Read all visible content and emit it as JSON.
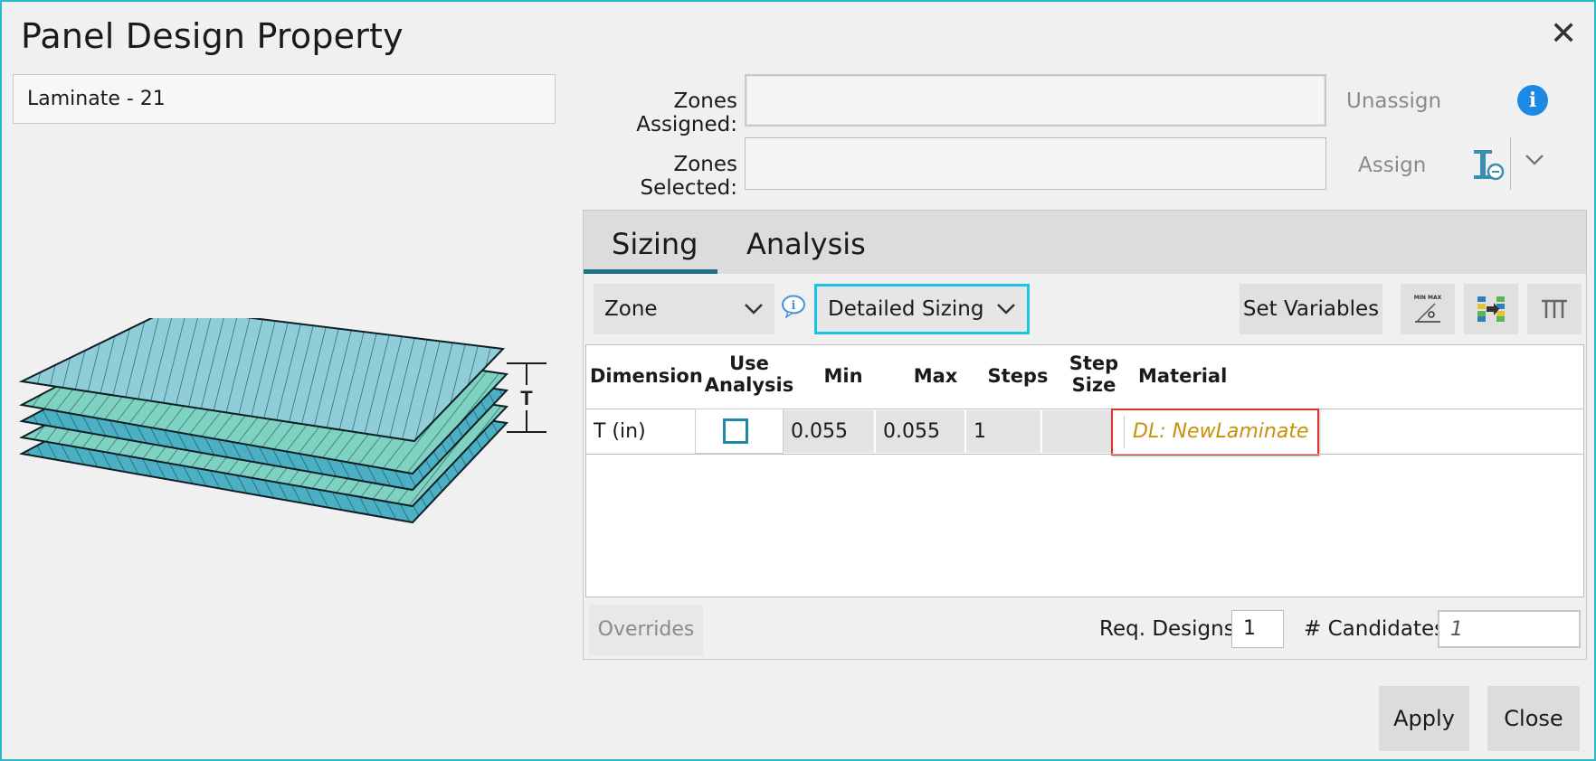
{
  "dialog": {
    "title": "Panel Design Property",
    "close_glyph": "✕"
  },
  "left": {
    "name_value": "Laminate - 21",
    "thickness_label": "T"
  },
  "zones": {
    "assigned_label": "Zones Assigned:",
    "selected_label": "Zones Selected:",
    "assigned_value": "",
    "selected_value": "",
    "unassign_label": "Unassign",
    "assign_label": "Assign",
    "info_glyph": "i"
  },
  "tabs": [
    {
      "label": "Sizing",
      "active": true
    },
    {
      "label": "Analysis",
      "active": false
    }
  ],
  "sizing": {
    "zone_dropdown": "Zone",
    "mode_dropdown": "Detailed Sizing",
    "set_variables_label": "Set Variables",
    "toolbar_icons": [
      "min-max-icon",
      "matrix-transfer-icon",
      "columns-icon"
    ],
    "min_max_icon_text": "MIN MAX",
    "columns": {
      "dimension": "Dimension",
      "use_analysis": [
        "Use",
        "Analysis"
      ],
      "min": "Min",
      "max": "Max",
      "steps": "Steps",
      "step_size": [
        "Step",
        "Size"
      ],
      "material": "Material"
    },
    "rows": [
      {
        "dimension": "T (in)",
        "use_analysis": false,
        "min": "0.055",
        "max": "0.055",
        "steps": "1",
        "step_size": "",
        "material": "DL: NewLaminate"
      }
    ],
    "overrides_label": "Overrides",
    "req_designs_label": "Req. Designs",
    "req_designs_value": "1",
    "candidates_label": "# Candidates",
    "candidates_value": "1"
  },
  "footer": {
    "apply_label": "Apply",
    "close_label": "Close"
  },
  "colors": {
    "accent": "#1ec2e8",
    "tab_underline": "#1f6f8b",
    "material_text": "#c8900c",
    "highlight_box": "#e03030",
    "info_blue": "#1e88e5"
  }
}
